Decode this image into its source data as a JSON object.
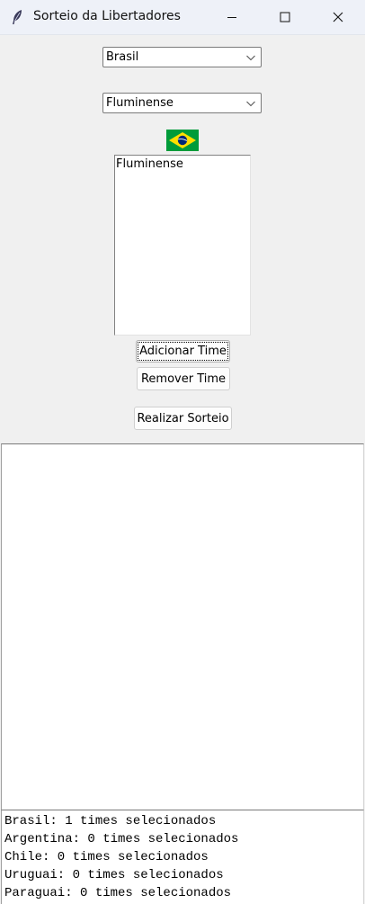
{
  "window": {
    "title": "Sorteio da Libertadores",
    "icon": "feather-icon"
  },
  "country_select": {
    "value": "Brasil"
  },
  "team_select": {
    "value": "Fluminense"
  },
  "flag": {
    "icon": "brazil-flag-icon",
    "colors": {
      "green": "#009b3a",
      "yellow": "#fedf00",
      "blue": "#002776"
    }
  },
  "teams_list": {
    "items": [
      "Fluminense"
    ]
  },
  "buttons": {
    "add": "Adicionar Time",
    "remove": "Remover Time",
    "draw": "Realizar Sorteio"
  },
  "output": {
    "text": ""
  },
  "summary": {
    "lines": [
      "Brasil: 1 times selecionados",
      "Argentina: 0 times selecionados",
      "Chile: 0 times selecionados",
      "Uruguai: 0 times selecionados",
      "Paraguai: 0 times selecionados"
    ]
  }
}
